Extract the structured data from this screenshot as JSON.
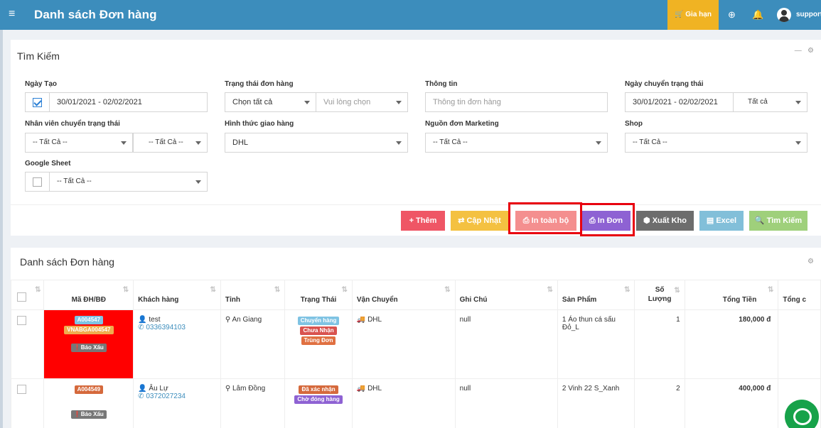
{
  "header": {
    "menu_icon": "hamburger-icon",
    "title": "Danh sách Đơn hàng",
    "renew_label": "Gia hạn",
    "icons": [
      "life-ring-icon",
      "bell-icon",
      "user-avatar-icon"
    ],
    "username": "support"
  },
  "search_panel": {
    "title": "Tìm Kiếm",
    "fields": {
      "created_date_label": "Ngày Tạo",
      "created_date_value": "30/01/2021 - 02/02/2021",
      "created_date_checked": true,
      "order_status_label": "Trạng thái đơn hàng",
      "order_status_value": "Chọn tất cả",
      "order_status_sub_placeholder": "Vui lòng chọn",
      "info_label": "Thông tin",
      "info_placeholder": "Thông tin đơn hàng",
      "status_change_date_label": "Ngày chuyển trạng thái",
      "status_change_date_value": "30/01/2021 - 02/02/2021",
      "status_change_scope": "Tất cả",
      "staff_change_label": "Nhân viên chuyển trạng thái",
      "staff_change_value1": "-- Tất Cả --",
      "staff_change_value2": "-- Tất Cả --",
      "shipping_method_label": "Hình thức giao hàng",
      "shipping_method_value": "DHL",
      "marketing_source_label": "Nguồn đơn Marketing",
      "marketing_source_value": "-- Tất Cả --",
      "shop_label": "Shop",
      "shop_value": "-- Tất Cả --",
      "google_sheet_label": "Google Sheet",
      "google_sheet_value": "-- Tất Cả --",
      "google_sheet_checked": false
    },
    "buttons": {
      "add": "+ Thêm",
      "update": "⇄ Cập Nhật",
      "print_all": "⎙ In toàn bộ",
      "print_order": "⎙ In Đơn",
      "export_stock": "⬢ Xuất Kho",
      "excel": "▤ Excel",
      "search": "🔍 Tìm Kiếm"
    },
    "colors": {
      "add": "#ef5665",
      "update": "#f4c141",
      "print_all": "#f48f8f",
      "print_order": "#8e62d3",
      "export_stock": "#6d6d6d",
      "excel": "#82bfd9",
      "search": "#9fd07b",
      "highlight": "#e8000f"
    }
  },
  "orders_panel": {
    "title": "Danh sách Đơn hàng",
    "columns": [
      "Mã ĐH/BĐ",
      "Khách hàng",
      "Tỉnh",
      "Trạng Thái",
      "Vận Chuyển",
      "Ghi Chú",
      "Sản Phẩm",
      "Số Lượng",
      "Tổng Tiền",
      "Tổng c"
    ],
    "column_quantity_top": "Số",
    "column_quantity_bottom": "Lượng",
    "rows": [
      {
        "order_code": "A004547",
        "tracking_code": "VNABGA004547",
        "report_badge": "Báo Xấu",
        "customer": "test",
        "phone": "0336394103",
        "province": "An Giang",
        "statuses": [
          {
            "text": "Chuyển hàng",
            "color": "#7fc3e3"
          },
          {
            "text": "Chưa Nhận",
            "color": "#d9534f"
          },
          {
            "text": "Trùng Đơn",
            "color": "#e07041"
          }
        ],
        "shipping": "DHL",
        "note": "null",
        "product_line1": "1 Áo thun cá sấu",
        "product_line2": "Đỏ_L",
        "quantity": "1",
        "total": "180,000 đ"
      },
      {
        "order_code": "A004549",
        "report_badge": "Báo Xấu",
        "customer": "Âu Lự",
        "phone": "0372027234",
        "province": "Lâm Đồng",
        "statuses": [
          {
            "text": "Đã xác nhận",
            "color": "#d5693c"
          },
          {
            "text": "Chờ đóng hàng",
            "color": "#8e62d3"
          }
        ],
        "shipping": "DHL",
        "note": "null",
        "product": "2 Vinh 22 S_Xanh",
        "quantity": "2",
        "total": "400,000 đ"
      }
    ]
  },
  "chat_widget_icon": "chat-bubble-icon"
}
